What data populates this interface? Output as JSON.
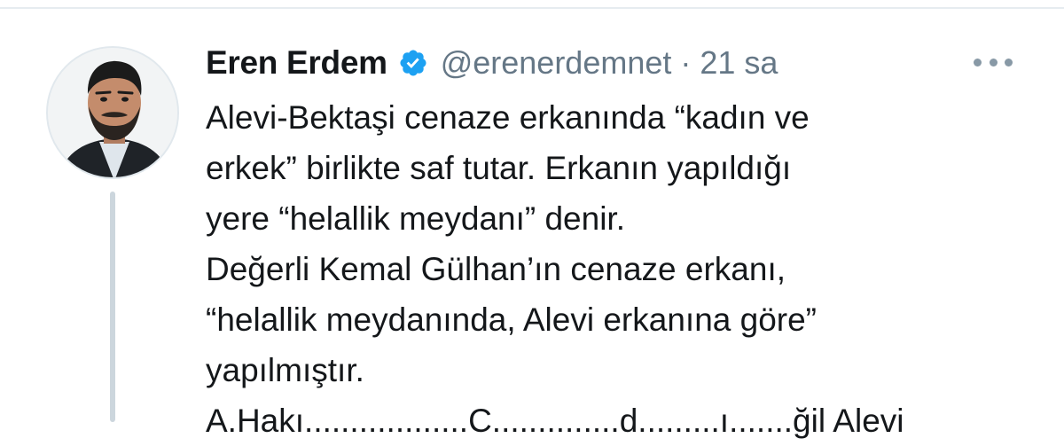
{
  "tweet": {
    "author": {
      "display_name": "Eren Erdem",
      "handle": "@erenerdemnet",
      "verified": true,
      "avatar_icon": "person-photo"
    },
    "separator": "·",
    "timestamp": "21 sa",
    "more_icon": "more-horizontal-icon",
    "text_lines": [
      "Alevi-Bektaşi cenaze erkanında “kadın ve",
      "erkek” birlikte saf tutar. Erkanın yapıldığı",
      "yere “helallik meydanı” denir.",
      "Değerli Kemal Gülhan’ın cenaze erkanı,",
      "“helallik meydanında, Alevi erkanına göre”",
      "yapılmıştır.",
      "A.Hakı..................C..............d.........ı.......ğil Alevi"
    ]
  },
  "colors": {
    "text_primary": "#14171a",
    "text_secondary": "#657786",
    "verified_blue": "#1da1f2",
    "thread_line": "#ccd6dd",
    "divider": "#e6ecf0"
  }
}
